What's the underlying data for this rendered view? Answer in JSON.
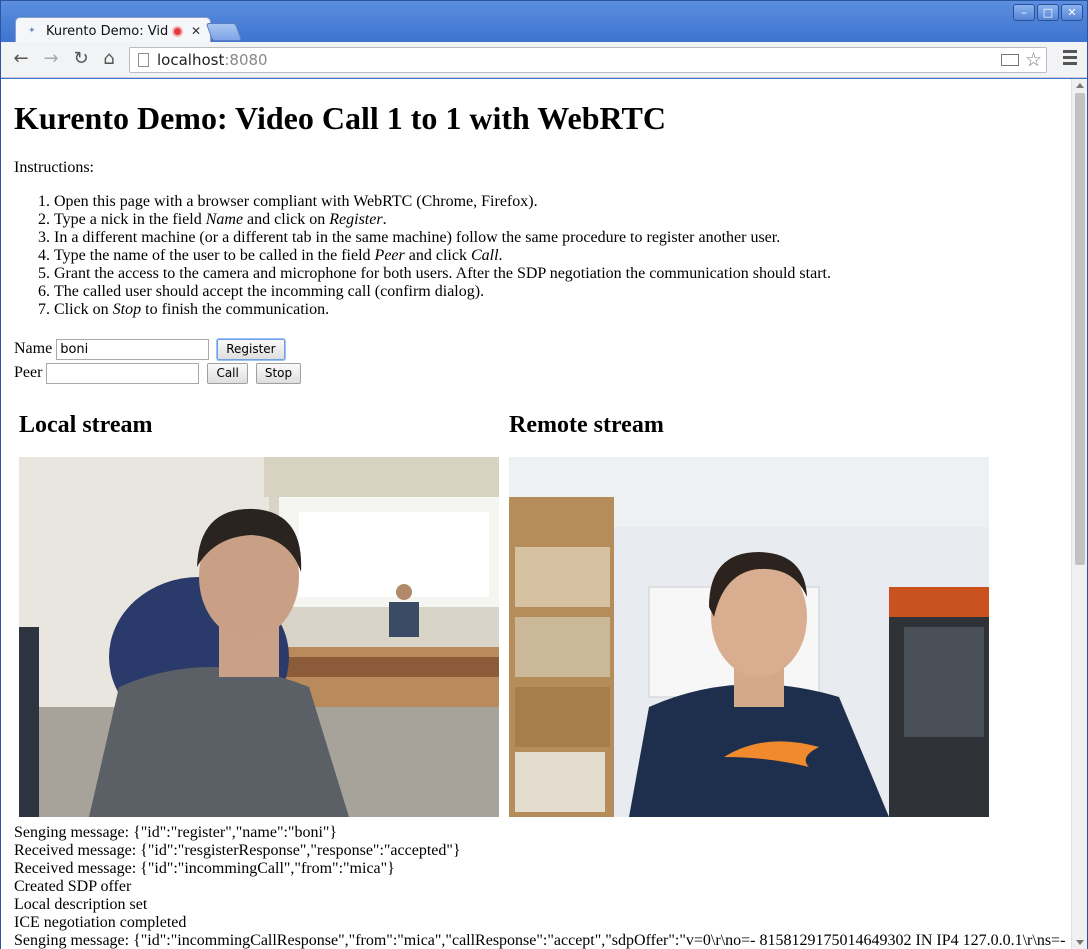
{
  "browser": {
    "tab_title": "Kurento Demo: Vid",
    "url_host": "localhost",
    "url_port": ":8080"
  },
  "page": {
    "title": "Kurento Demo: Video Call 1 to 1 with WebRTC",
    "instructions_label": "Instructions:",
    "steps": [
      {
        "before": "Open this page with a browser compliant with WebRTC (Chrome, Firefox).",
        "em": "",
        "mid": "",
        "em2": "",
        "after": ""
      },
      {
        "before": "Type a nick in the field ",
        "em": "Name",
        "mid": " and click on ",
        "em2": "Register",
        "after": "."
      },
      {
        "before": "In a different machine (or a different tab in the same machine) follow the same procedure to register another user.",
        "em": "",
        "mid": "",
        "em2": "",
        "after": ""
      },
      {
        "before": "Type the name of the user to be called in the field ",
        "em": "Peer",
        "mid": " and click ",
        "em2": "Call",
        "after": "."
      },
      {
        "before": "Grant the access to the camera and microphone for both users. After the SDP negotiation the communication should start.",
        "em": "",
        "mid": "",
        "em2": "",
        "after": ""
      },
      {
        "before": "The called user should accept the incomming call (confirm dialog).",
        "em": "",
        "mid": "",
        "em2": "",
        "after": ""
      },
      {
        "before": "Click on ",
        "em": "Stop",
        "mid": " to finish the communication.",
        "em2": "",
        "after": ""
      }
    ],
    "form": {
      "name_label": "Name",
      "name_value": "boni",
      "register_label": "Register",
      "peer_label": "Peer",
      "peer_value": "",
      "call_label": "Call",
      "stop_label": "Stop"
    },
    "local_stream_title": "Local stream",
    "remote_stream_title": "Remote stream",
    "log": [
      "Senging message: {\"id\":\"register\",\"name\":\"boni\"}",
      "Received message: {\"id\":\"resgisterResponse\",\"response\":\"accepted\"}",
      "Received message: {\"id\":\"incommingCall\",\"from\":\"mica\"}",
      "Created SDP offer",
      "Local description set",
      "ICE negotiation completed",
      "Senging message: {\"id\":\"incommingCallResponse\",\"from\":\"mica\",\"callResponse\":\"accept\",\"sdpOffer\":\"v=0\\r\\no=- 8158129175014649302 IN IP4 127.0.0.1\\r\\ns=-"
    ]
  }
}
